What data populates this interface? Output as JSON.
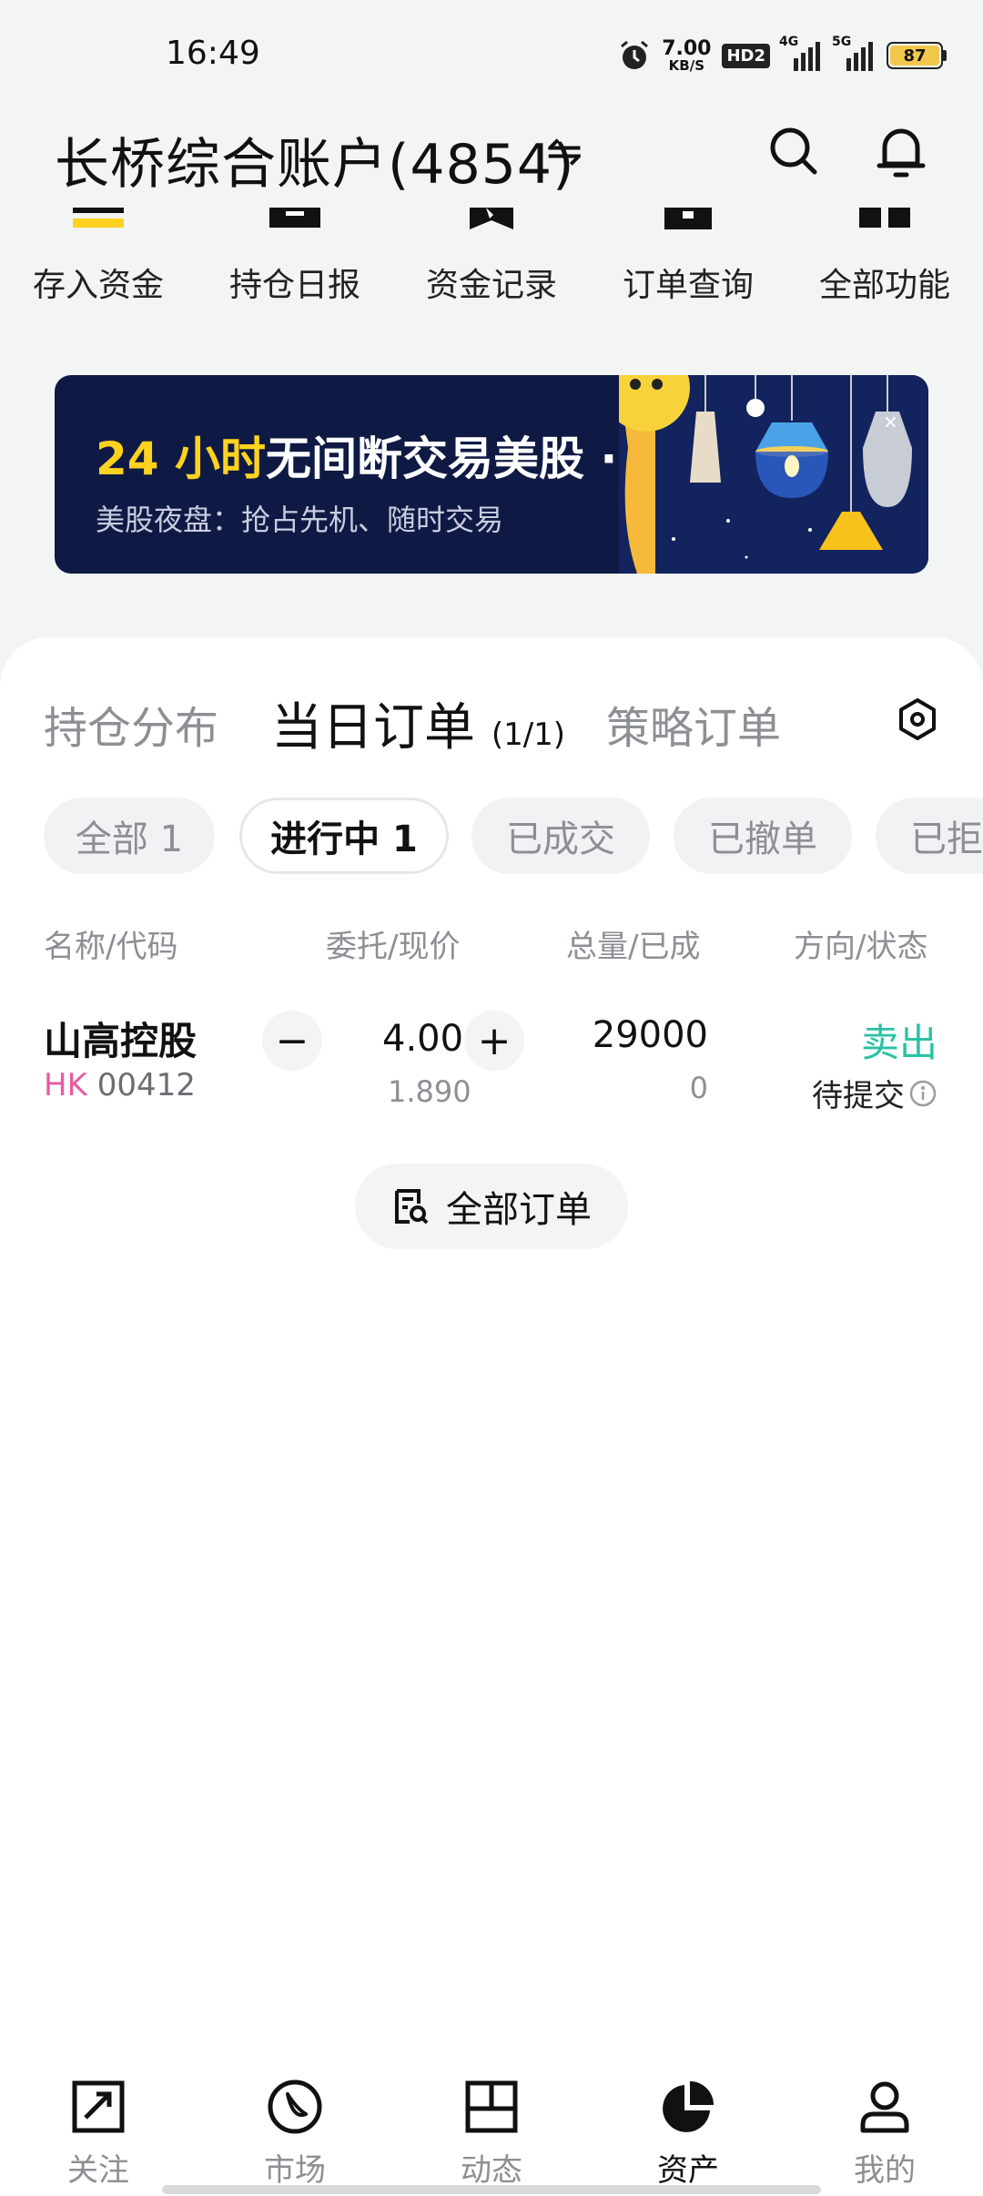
{
  "status_bar": {
    "time": "16:49",
    "net_speed_value": "7.00",
    "net_speed_unit": "KB/S",
    "hd_badge": "HD2",
    "signal1_label": "4G",
    "signal2_label": "5G",
    "battery": "87",
    "icons": [
      "alarm-icon",
      "hd-icon",
      "signal-icon",
      "signal-icon",
      "battery-icon"
    ]
  },
  "header": {
    "title": "长桥综合账户(4854)",
    "swap_glyph": "⇋"
  },
  "shortcuts": [
    {
      "label": "存入资金",
      "icon": "deposit-icon"
    },
    {
      "label": "持仓日报",
      "icon": "report-icon"
    },
    {
      "label": "资金记录",
      "icon": "record-icon"
    },
    {
      "label": "订单查询",
      "icon": "order-query-icon"
    },
    {
      "label": "全部功能",
      "icon": "all-functions-icon"
    }
  ],
  "banner": {
    "title_highlight": "24 小时",
    "title_rest": "无间断交易美股 ·",
    "subtitle": "美股夜盘：抢占先机、随时交易"
  },
  "tabs": {
    "holdings": "持仓分布",
    "today_orders": "当日订单",
    "today_orders_count": "(1/1)",
    "strategy_orders": "策略订单"
  },
  "chips": [
    "全部 1",
    "进行中 1",
    "已成交",
    "已撤单",
    "已拒"
  ],
  "columns": {
    "name": "名称/代码",
    "price": "委托/现价",
    "qty": "总量/已成",
    "status": "方向/状态"
  },
  "order": {
    "name": "山高控股",
    "market": "HK",
    "code": "00412",
    "minus": "−",
    "plus": "+",
    "order_price": "4.00",
    "current_price": "1.890",
    "total_qty": "29000",
    "filled_qty": "0",
    "direction": "卖出",
    "status": "待提交"
  },
  "all_orders_label": "全部订单",
  "colors": {
    "sell": "#28c2a3",
    "market_hk": "#e85aa0",
    "banner_bg": "#0f1a44",
    "banner_highlight": "#ffd21f"
  },
  "bottom_nav": [
    {
      "label": "关注",
      "icon": "watchlist-icon"
    },
    {
      "label": "市场",
      "icon": "market-icon"
    },
    {
      "label": "动态",
      "icon": "feed-icon"
    },
    {
      "label": "资产",
      "icon": "assets-icon",
      "active": true
    },
    {
      "label": "我的",
      "icon": "profile-icon"
    }
  ]
}
